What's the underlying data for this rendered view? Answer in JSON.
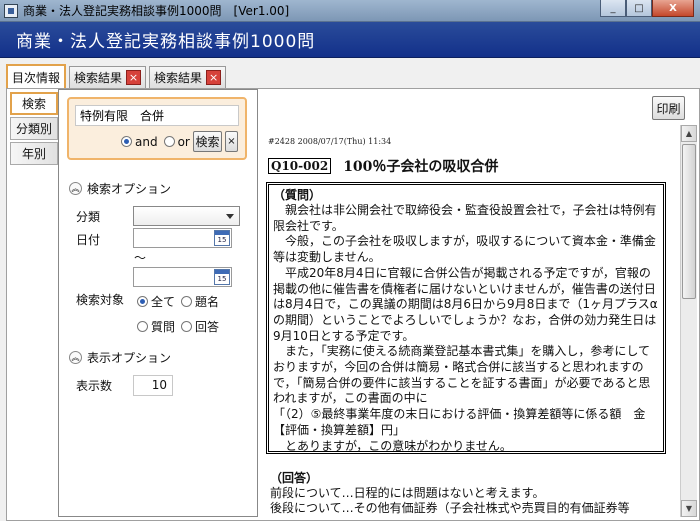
{
  "window": {
    "title": "商業・法人登記実務相談事例1000問　[Ver1.00]",
    "min": "_",
    "max": "□",
    "close": "X"
  },
  "header": {
    "title": "商業・法人登記実務相談事例1000問"
  },
  "tabs": [
    {
      "label": "目次情報",
      "closable": false
    },
    {
      "label": "検索結果",
      "closable": true
    },
    {
      "label": "検索結果",
      "closable": true
    }
  ],
  "tab_close_glyph": "×",
  "side_tabs": [
    "検索",
    "分類別",
    "年別"
  ],
  "search": {
    "query": "特例有限　合併",
    "and_label": "and",
    "or_label": "or",
    "mode": "and",
    "search_button": "検索",
    "clear_button": "×"
  },
  "search_options": {
    "heading": "検索オプション",
    "category_label": "分類",
    "category_value": "",
    "date_label": "日付",
    "date_from": "",
    "date_to": "",
    "date_separator": "～",
    "calendar_day": "15",
    "target_label": "検索対象",
    "targets": [
      "全て",
      "題名",
      "質問",
      "回答"
    ],
    "target_selected": "全て"
  },
  "display_options": {
    "heading": "表示オプション",
    "count_label": "表示数",
    "count_value": "10"
  },
  "content": {
    "print_button": "印刷",
    "meta": "#2428 2008/07/17(Thu) 11:34",
    "qid": "Q10-002",
    "title": "100％子会社の吸収合併",
    "question_head": "（質問）",
    "question_paragraphs": [
      "　親会社は非公開会社で取締役会・監査役設置会社で，子会社は特例有限会社です。",
      "　今般，この子会社を吸収しますが，吸収するについて資本金・準備金等は変動しません。",
      "　平成20年8月4日に官報に合併公告が掲載される予定ですが，官報の掲載の他に催告書を債権者に届けないといけませんが，催告書の送付日は8月4日で，この異議の期間は8月6日から9月8日まで（1ヶ月プラスαの期間）ということでよろしいでしょうか？なお，合併の効力発生日は9月10日とする予定です。",
      "　また，「実務に使える続商業登記基本書式集」を購入し，参考にしておりますが，今回の合併は簡易・略式合併に該当すると思われますので，「簡易合併の要件に該当することを証する書面」が必要であると思われますが，この書面の中に",
      "「（2）⑤最終事業年度の末日における評価・換算差額等に係る額　金【評価・換算差額】円」",
      "　とありますが，この意味がわかりません。"
    ],
    "answer_head": "（回答）",
    "answer_lines": [
      "前段について…日程的には問題はないと考えます。",
      "後段について…その他有価証券（子会社株式や売買目的有価証券等"
    ]
  }
}
